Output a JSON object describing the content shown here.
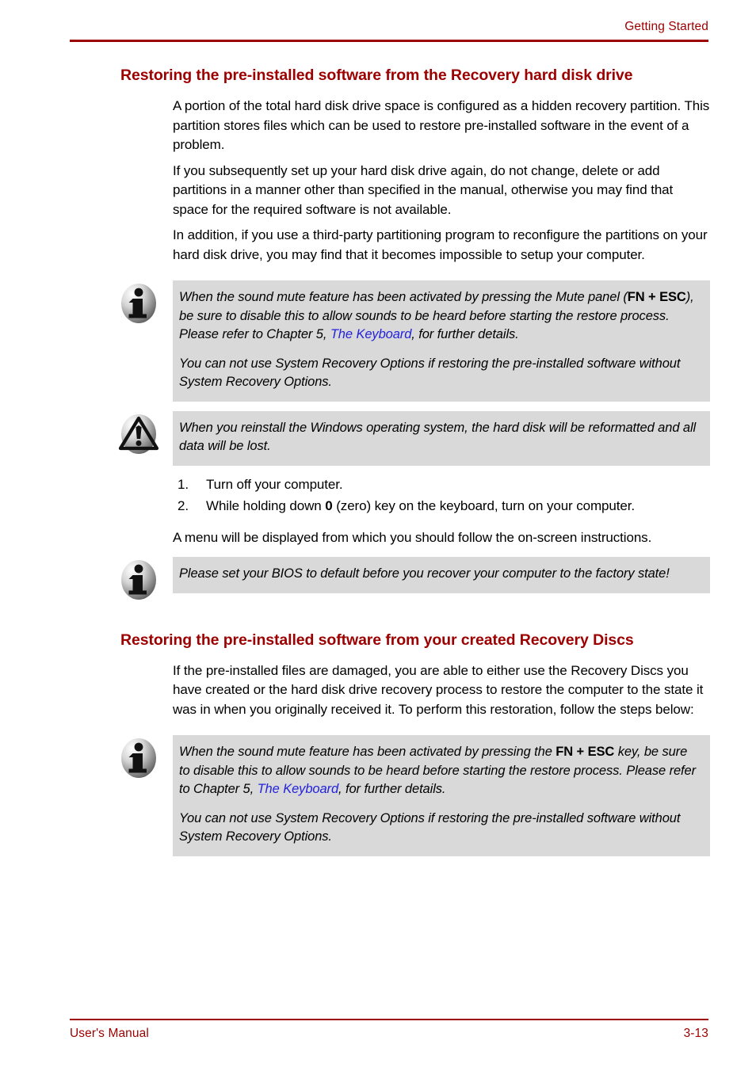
{
  "header": {
    "title": "Getting Started"
  },
  "sections": [
    {
      "heading": "Restoring the pre-installed software from the Recovery hard disk drive",
      "paragraphs": [
        "A portion of the total hard disk drive space is configured as a hidden recovery partition. This partition stores files which can be used to restore pre-installed software in the event of a problem.",
        "If you subsequently set up your hard disk drive again, do not change, delete or add partitions in a manner other than specified in the manual, otherwise you may find that space for the required software is not available.",
        "In addition, if you use a third-party partitioning program to reconfigure the partitions on your hard disk drive, you may find that it becomes impossible to setup your computer."
      ]
    },
    {
      "heading": "Restoring the pre-installed software from your created Recovery Discs",
      "paragraphs": [
        "If the pre-installed files are damaged, you are able to either use the Recovery Discs you have created or the hard disk drive recovery process to restore the computer to the state it was in when you originally received it. To perform this restoration, follow the steps below:"
      ]
    }
  ],
  "callout_info_1": {
    "icon": "info-icon",
    "p1_part1": "When the sound mute feature has been activated by pressing the Mute panel (",
    "p1_key1": "FN",
    "p1_plus": " + ",
    "p1_key2": "ESC",
    "p1_part2": "), be sure to disable this to allow sounds to be heard before starting the restore process. Please refer to Chapter 5, ",
    "p1_link": "The Keyboard",
    "p1_part3": ", for further details.",
    "p2": "You can not use System Recovery Options if restoring the pre-installed software without System Recovery Options."
  },
  "callout_warning": {
    "icon": "warning-icon",
    "p1": "When you reinstall the Windows operating system, the hard disk will be reformatted and all data will be lost."
  },
  "steps": [
    {
      "num": "1.",
      "text": "Turn off your computer."
    },
    {
      "num": "2.",
      "text_part1": "While holding down ",
      "bold": "0",
      "text_part2": " (zero) key on the keyboard, turn on your computer."
    }
  ],
  "after_steps_paragraph": "A menu will be displayed from which you should follow the on-screen instructions.",
  "callout_info_2": {
    "icon": "info-icon",
    "p1": "Please set your BIOS to default before you  recover your computer to the factory state!"
  },
  "callout_info_3": {
    "icon": "info-icon",
    "p1_part1": "When the sound mute feature has been activated by pressing the ",
    "p1_key1": "FN",
    "p1_plus": " + ",
    "p1_key2": "ESC",
    "p1_part2": " key, be sure to disable this to allow sounds to be heard before starting the restore process. Please refer to Chapter 5, ",
    "p1_link": "The Keyboard",
    "p1_part3": ", for further details.",
    "p2": "You can not use System Recovery Options if restoring the pre-installed software without System Recovery Options."
  },
  "footer": {
    "left": "User's Manual",
    "right": "3-13"
  },
  "colors": {
    "accent_red": "#9C0000",
    "callout_bg": "#D9D9D9",
    "link_blue": "#2222DD",
    "text": "#000000"
  }
}
